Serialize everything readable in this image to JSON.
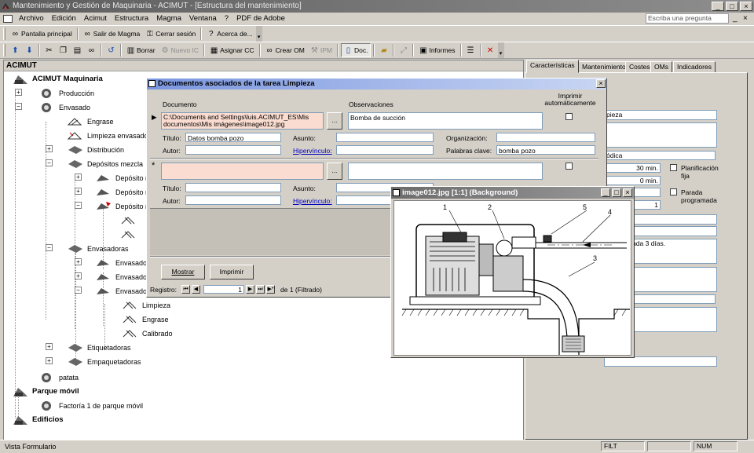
{
  "window": {
    "title": "Mantenimiento y Gestión de Maquinaria - ACIMUT - [Estructura del mantenimiento]",
    "controls": [
      "_",
      "□",
      "×"
    ]
  },
  "menu": {
    "items": [
      "Archivo",
      "Edición",
      "Acimut",
      "Estructura",
      "Magma",
      "Ventana",
      "?",
      "PDF de Adobe"
    ],
    "ask_placeholder": "Escriba una pregunta"
  },
  "toolbar1": {
    "home": "Pantalla principal",
    "exit_magma": "Salir de Magma",
    "logout": "Cerrar sesión",
    "about": "Acerca de..."
  },
  "toolbar2": {
    "delete": "Borrar",
    "new_ic": "Nuevo IC",
    "assign_cc": "Asignar CC",
    "create_om": "Crear OM",
    "ipm": "IPM",
    "doc": "Doc.",
    "reports": "Informes"
  },
  "tree": {
    "header": "ACIMUT",
    "nodes": {
      "root": "ACIMUT Maquinaria",
      "produccion": "Producción",
      "envasado": "Envasado",
      "engrase": "Engrase",
      "limpieza_env": "Limpieza envasado",
      "distribucion": "Distribución",
      "depositos": "Depósitos mezcla",
      "deposito1": "Depósito m",
      "deposito2": "Depósito m",
      "deposito3": "Depósito m",
      "envasadoras": "Envasadoras",
      "envasado1": "Envasado",
      "envasado2": "Envasado",
      "envasado3": "Envasado",
      "limpieza": "Limpieza",
      "engrase2": "Engrase",
      "calibrado": "Calibrado",
      "etiquetadoras": "Etiquetadoras",
      "empaquetadoras": "Empaquetadoras",
      "patata": "patata",
      "parque": "Parque móvil",
      "factoria": "Factoría 1 de parque móvil",
      "edificios": "Edificios"
    }
  },
  "right_panel": {
    "tabs": [
      "Características",
      "Mantenimiento",
      "Costes",
      "OMs",
      "Indicadores"
    ],
    "f1": "pieza",
    "f2": "ódica",
    "f3": "30 min.",
    "f4": "0 min.",
    "f5": "undo",
    "f6": "1",
    "planificacion": "Planificación fija",
    "parada": "Parada programada",
    "f7": "sado",
    "f8": "Diaria: Cada 3 días."
  },
  "doc_window": {
    "title": "Documentos asociados de la tarea Limpieza",
    "col_documento": "Documento",
    "col_observaciones": "Observaciones",
    "col_imprimir": "Imprimir automáticamente",
    "rec1_path": "C:\\Documents and Settings\\luis.ACIMUT_ES\\Mis documentos\\Mis imágenes\\image012.jpg",
    "rec1_obs": "Bomba de succión",
    "lbl_titulo": "Título:",
    "lbl_autor": "Autor:",
    "lbl_asunto": "Asunto:",
    "lbl_hipervinculo": "Hipervínculo:",
    "lbl_organizacion": "Organización:",
    "lbl_palabras": "Palabras clave:",
    "rec1_titulo": "Datos bomba pozo",
    "rec1_palabras": "bomba pozo",
    "browse": "...",
    "btn_mostrar": "Mostrar",
    "btn_imprimir": "Imprimir",
    "lbl_registro": "Registro:",
    "nav_current": "1",
    "nav_total": "de 1 (Filtrado)",
    "row_marker1": "▶",
    "row_marker2": "*"
  },
  "image_window": {
    "title": "image012.jpg [1:1] (Background)",
    "callouts": [
      "1",
      "2",
      "5",
      "4",
      "3"
    ]
  },
  "status": {
    "left": "Vista Formulario",
    "filt": "FILT",
    "num": "NUM"
  }
}
